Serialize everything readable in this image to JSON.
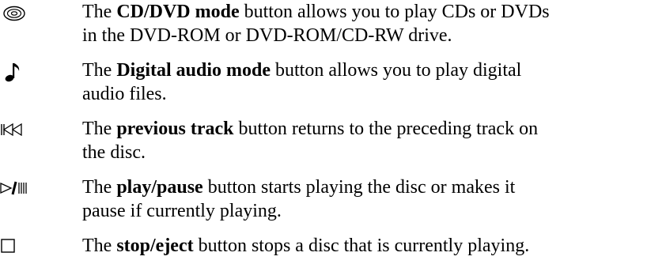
{
  "entries": [
    {
      "icon": "cd-dvd-disc-icon",
      "line1_pre": "The ",
      "line1_bold": "CD/DVD mode",
      "line1_post": " button allows you to play CDs or DVDs",
      "line2": "in the DVD-ROM or DVD-ROM/CD-RW drive."
    },
    {
      "icon": "music-note-icon",
      "line1_pre": "The ",
      "line1_bold": "Digital audio mode",
      "line1_post": " button allows you to play digital",
      "line2": "audio files."
    },
    {
      "icon": "previous-track-icon",
      "line1_pre": "The ",
      "line1_bold": "previous track",
      "line1_post": " button returns to the preceding track on",
      "line2": "the disc."
    },
    {
      "icon": "play-pause-icon",
      "line1_pre": "The ",
      "line1_bold": "play/pause",
      "line1_post": " button starts playing the disc or makes it",
      "line2": "pause if currently playing."
    },
    {
      "icon": "stop-eject-icon",
      "line1_pre": "The ",
      "line1_bold": "stop/eject",
      "line1_post": " button stops a disc that is currently playing."
    }
  ]
}
